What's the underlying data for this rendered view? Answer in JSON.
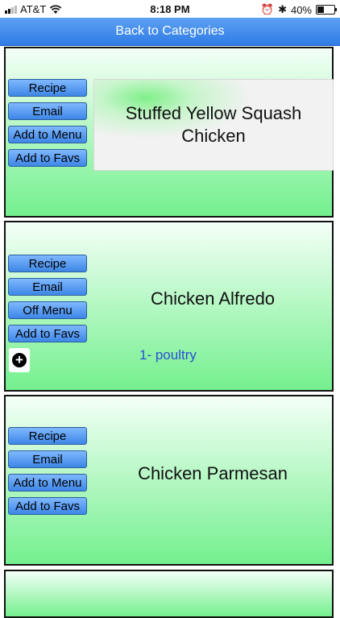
{
  "status_bar": {
    "carrier": "AT&T",
    "time": "8:18 PM",
    "battery": "40%",
    "battery_level": 0.4
  },
  "nav": {
    "back_label": "Back to Categories"
  },
  "recipes": [
    {
      "title": "Stuffed Yellow Squash Chicken",
      "buttons": {
        "recipe": "Recipe",
        "email": "Email",
        "menu": "Add to Menu",
        "favs": "Add to Favs"
      }
    },
    {
      "title": "Chicken Alfredo",
      "buttons": {
        "recipe": "Recipe",
        "email": "Email",
        "menu": "Off Menu",
        "favs": "Add to Favs"
      },
      "category_tag": "1- poultry",
      "expand_icon": "plus-circle-icon"
    },
    {
      "title": "Chicken Parmesan",
      "buttons": {
        "recipe": "Recipe",
        "email": "Email",
        "menu": "Add to Menu",
        "favs": "Add to Favs"
      }
    }
  ],
  "colors": {
    "nav_blue": "#2f7ce6",
    "card_green": "#74f08e",
    "tag_blue": "#2b4fd6"
  }
}
